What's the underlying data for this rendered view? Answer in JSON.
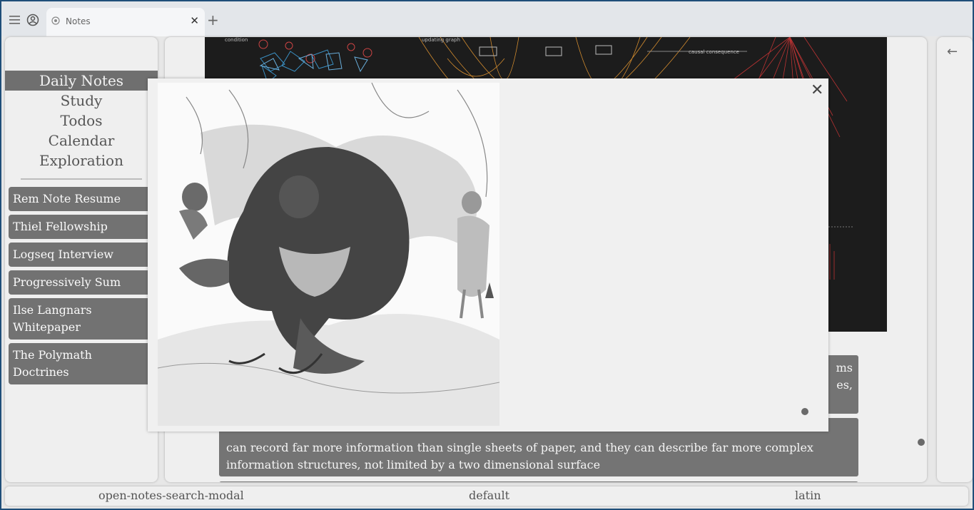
{
  "browser": {
    "tab_title": "Notes",
    "tab_close": "✕",
    "new_tab": "+"
  },
  "sidebar": {
    "nav": [
      "Daily Notes",
      "Study",
      "Todos",
      "Calendar",
      "Exploration"
    ],
    "active_nav": "Daily Notes",
    "notes": [
      {
        "line1": "Rem Note Resume",
        "line2": ""
      },
      {
        "line1": "Thiel Fellowship",
        "line2": ""
      },
      {
        "line1": "Logseq Interview",
        "line2": ""
      },
      {
        "line1": "Progressively Sum",
        "line2": ""
      },
      {
        "line1": "Ilse Langnars",
        "line2": "Whitepaper"
      },
      {
        "line1": "The Polymath",
        "line2": "Doctrines"
      }
    ]
  },
  "right_panel": {
    "back_icon": "←"
  },
  "diagram": {
    "labels": [
      "condition",
      "updating graph",
      "causal consequence"
    ]
  },
  "content": {
    "block1_fragments": [
      "ms",
      "es,"
    ],
    "block2_lines": [
      "can record far more information than single sheets of paper, and they can describe far more complex",
      "information structures, not limited by a two dimensional surface"
    ]
  },
  "modal": {
    "close_label": "✕",
    "image_alt": "Illustration of a hunched giant crouching in snow with two giants in the background"
  },
  "statusbar": {
    "left": "open-notes-search-modal",
    "center": "default",
    "right": "latin"
  },
  "colors": {
    "active_nav_bg": "#6f6f6f",
    "note_button_bg": "#727272",
    "frame_border": "#1f4e79"
  }
}
